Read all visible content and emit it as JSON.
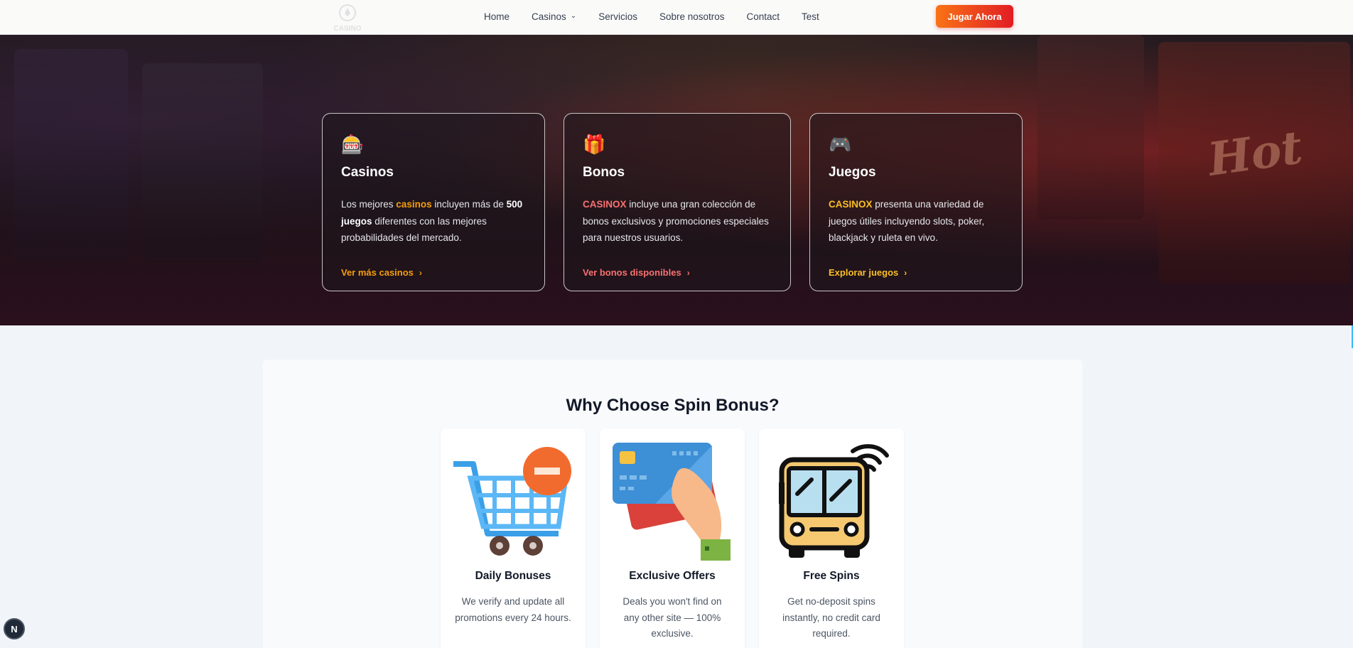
{
  "nav": {
    "logo_text": "CASINO",
    "links": [
      {
        "label": "Home"
      },
      {
        "label": "Casinos",
        "has_dropdown": true
      },
      {
        "label": "Servicios"
      },
      {
        "label": "Sobre nosotros"
      },
      {
        "label": "Contact"
      },
      {
        "label": "Test"
      }
    ],
    "cta_label": "Jugar Ahora",
    "cta_gradient": [
      "#f97316",
      "#e11d24"
    ]
  },
  "hero": {
    "cards": [
      {
        "icon": "slot-machine-icon",
        "title": "Casinos",
        "text_parts": {
          "p1": "Los mejores ",
          "hl": "casinos",
          "p2": " incluyen más de ",
          "bold": "500 juegos",
          "p3": " diferentes con las mejores probabilidades del mercado."
        },
        "link_label": "Ver más casinos",
        "link_color": "#f59e0b"
      },
      {
        "icon": "gift-icon",
        "title": "Bonos",
        "text_parts": {
          "hl": "CASINOX",
          "p1": " incluye una gran colección de bonos exclusivos y promociones especiales para nuestros usuarios."
        },
        "link_label": "Ver bonos disponibles",
        "link_color": "#f87171"
      },
      {
        "icon": "game-controller-icon",
        "title": "Juegos",
        "text_parts": {
          "hl": "CASINOX",
          "p1": " presenta una variedad de juegos útiles incluyendo slots, poker, blackjack y ruleta en vivo."
        },
        "link_label": "Explorar juegos",
        "link_color": "#fbbf24"
      }
    ]
  },
  "why": {
    "title": "Why Choose Spin Bonus?",
    "features": [
      {
        "icon": "shopping-cart-icon",
        "title": "Daily Bonuses",
        "text": "We verify and update all promotions every 24 hours."
      },
      {
        "icon": "credit-card-icon",
        "title": "Exclusive Offers",
        "text": "Deals you won't find on any other site — 100% exclusive."
      },
      {
        "icon": "bus-wifi-icon",
        "title": "Free Spins",
        "text": "Get no-deposit spins instantly, no credit card required."
      }
    ]
  },
  "dev_badge": "N"
}
